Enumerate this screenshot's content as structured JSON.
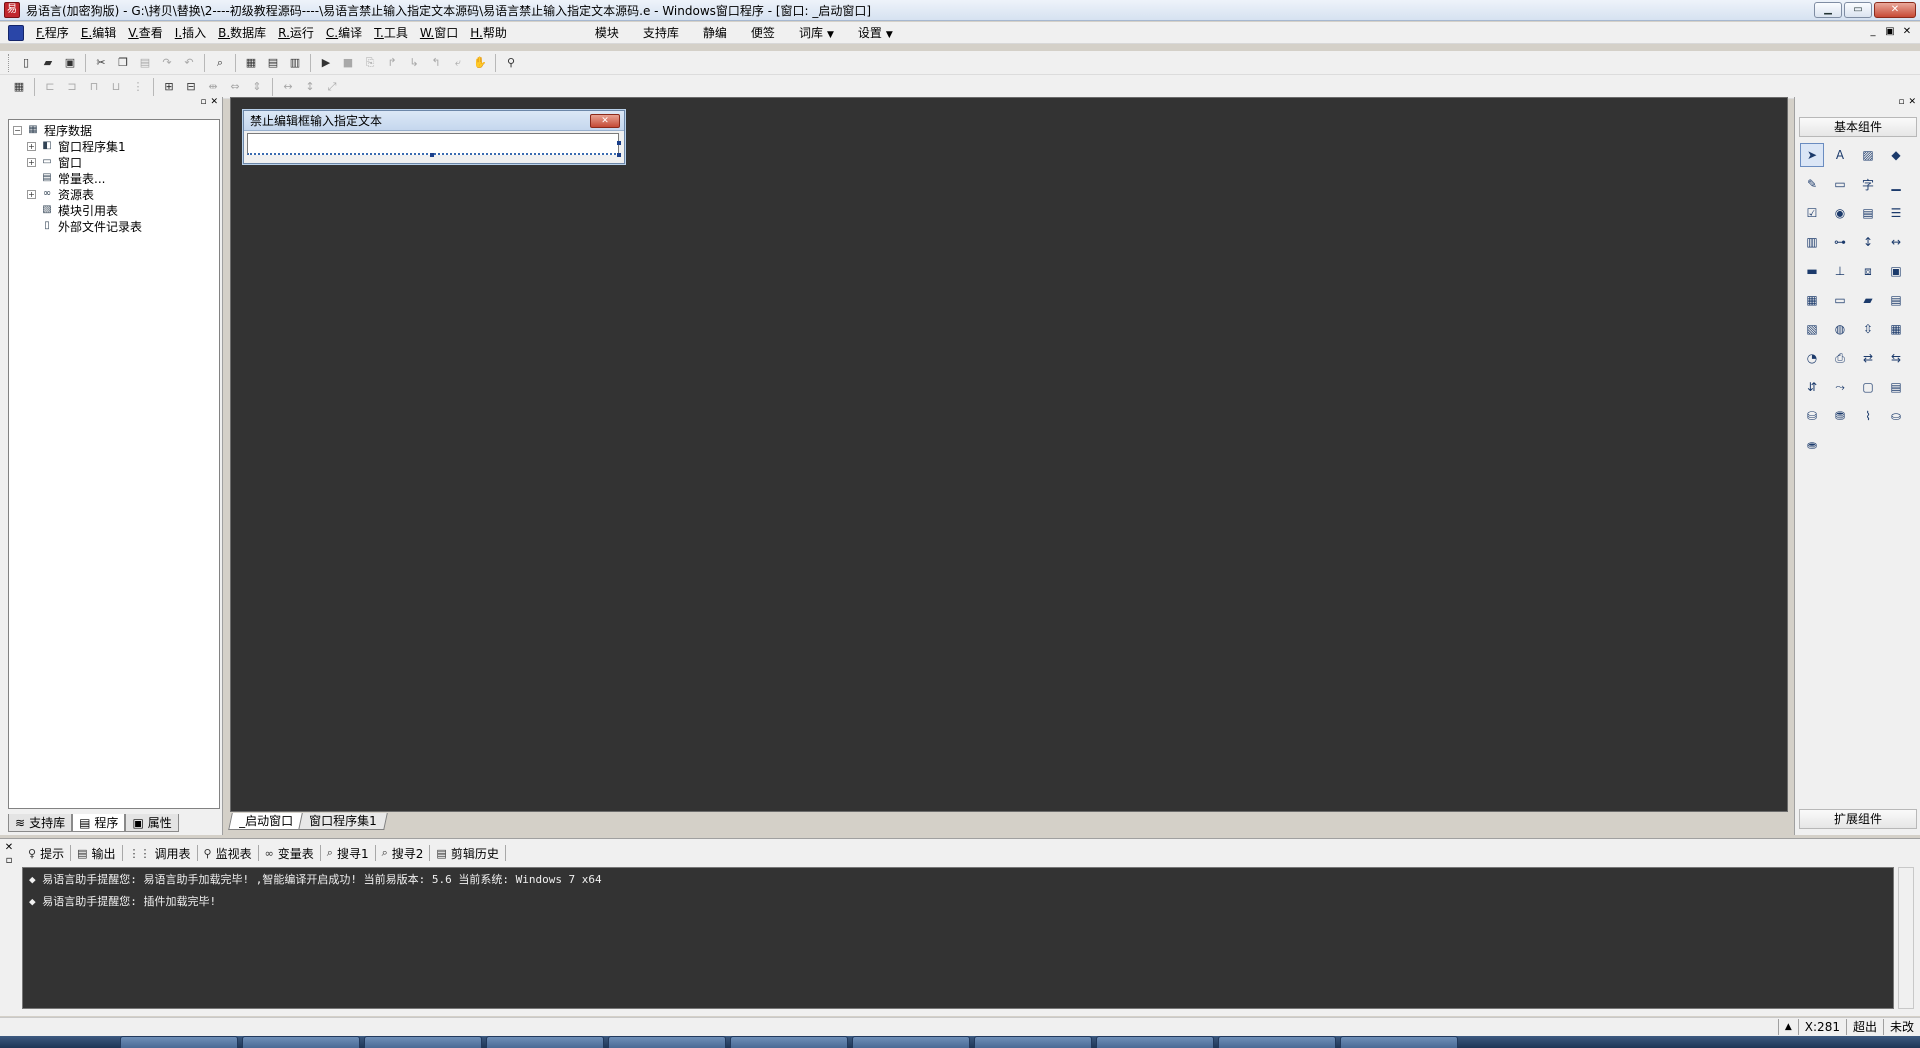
{
  "window": {
    "title": "易语言(加密狗版) - G:\\拷贝\\替换\\2----初级教程源码----\\易语言禁止输入指定文本源码\\易语言禁止输入指定文本源码.e - Windows窗口程序 - [窗口: _启动窗口]",
    "min": "▁",
    "restore": "▭",
    "close": "✕"
  },
  "menu": {
    "items": [
      "F.程序",
      "E.编辑",
      "V.查看",
      "I.插入",
      "B.数据库",
      "R.运行",
      "C.编译",
      "T.工具",
      "W.窗口",
      "H.帮助"
    ],
    "extras": [
      "模块",
      "支持库",
      "静编",
      "便签",
      "词库",
      "设置"
    ],
    "mdi": [
      "_",
      "▣",
      "✕"
    ]
  },
  "left_panel": {
    "tree": [
      {
        "label": "程序数据",
        "icon": "database-icon",
        "level": 0,
        "expander": "-"
      },
      {
        "label": "窗口程序集1",
        "icon": "module-icon",
        "level": 1,
        "expander": "+"
      },
      {
        "label": "窗口",
        "icon": "window-icon",
        "level": 1,
        "expander": "+"
      },
      {
        "label": "常量表...",
        "icon": "constant-icon",
        "level": 1,
        "expander": ""
      },
      {
        "label": "资源表",
        "icon": "resource-icon",
        "level": 1,
        "expander": "+"
      },
      {
        "label": "模块引用表",
        "icon": "module-ref-icon",
        "level": 1,
        "expander": ""
      },
      {
        "label": "外部文件记录表",
        "icon": "file-icon",
        "level": 1,
        "expander": ""
      }
    ],
    "tabs": [
      "支持库",
      "程序",
      "属性"
    ]
  },
  "designer": {
    "form_title": "禁止编辑框输入指定文本",
    "tabs": [
      "_启动窗口",
      "窗口程序集1"
    ]
  },
  "palette": {
    "header": "基本组件",
    "footer": "扩展组件"
  },
  "output": {
    "tabs": [
      "提示",
      "输出",
      "调用表",
      "监视表",
      "变量表",
      "搜寻1",
      "搜寻2",
      "剪辑历史"
    ],
    "lines": [
      "◆ 易语言助手提醒您: 易语言助手加载完毕! ,智能编译开启成功! 当前易版本: 5.6 当前系统: Windows 7 x64",
      "◆ 易语言助手提醒您: 插件加载完毕!"
    ]
  },
  "status": {
    "coord": "X:281",
    "overwrite": "超出",
    "modified": "未改"
  }
}
